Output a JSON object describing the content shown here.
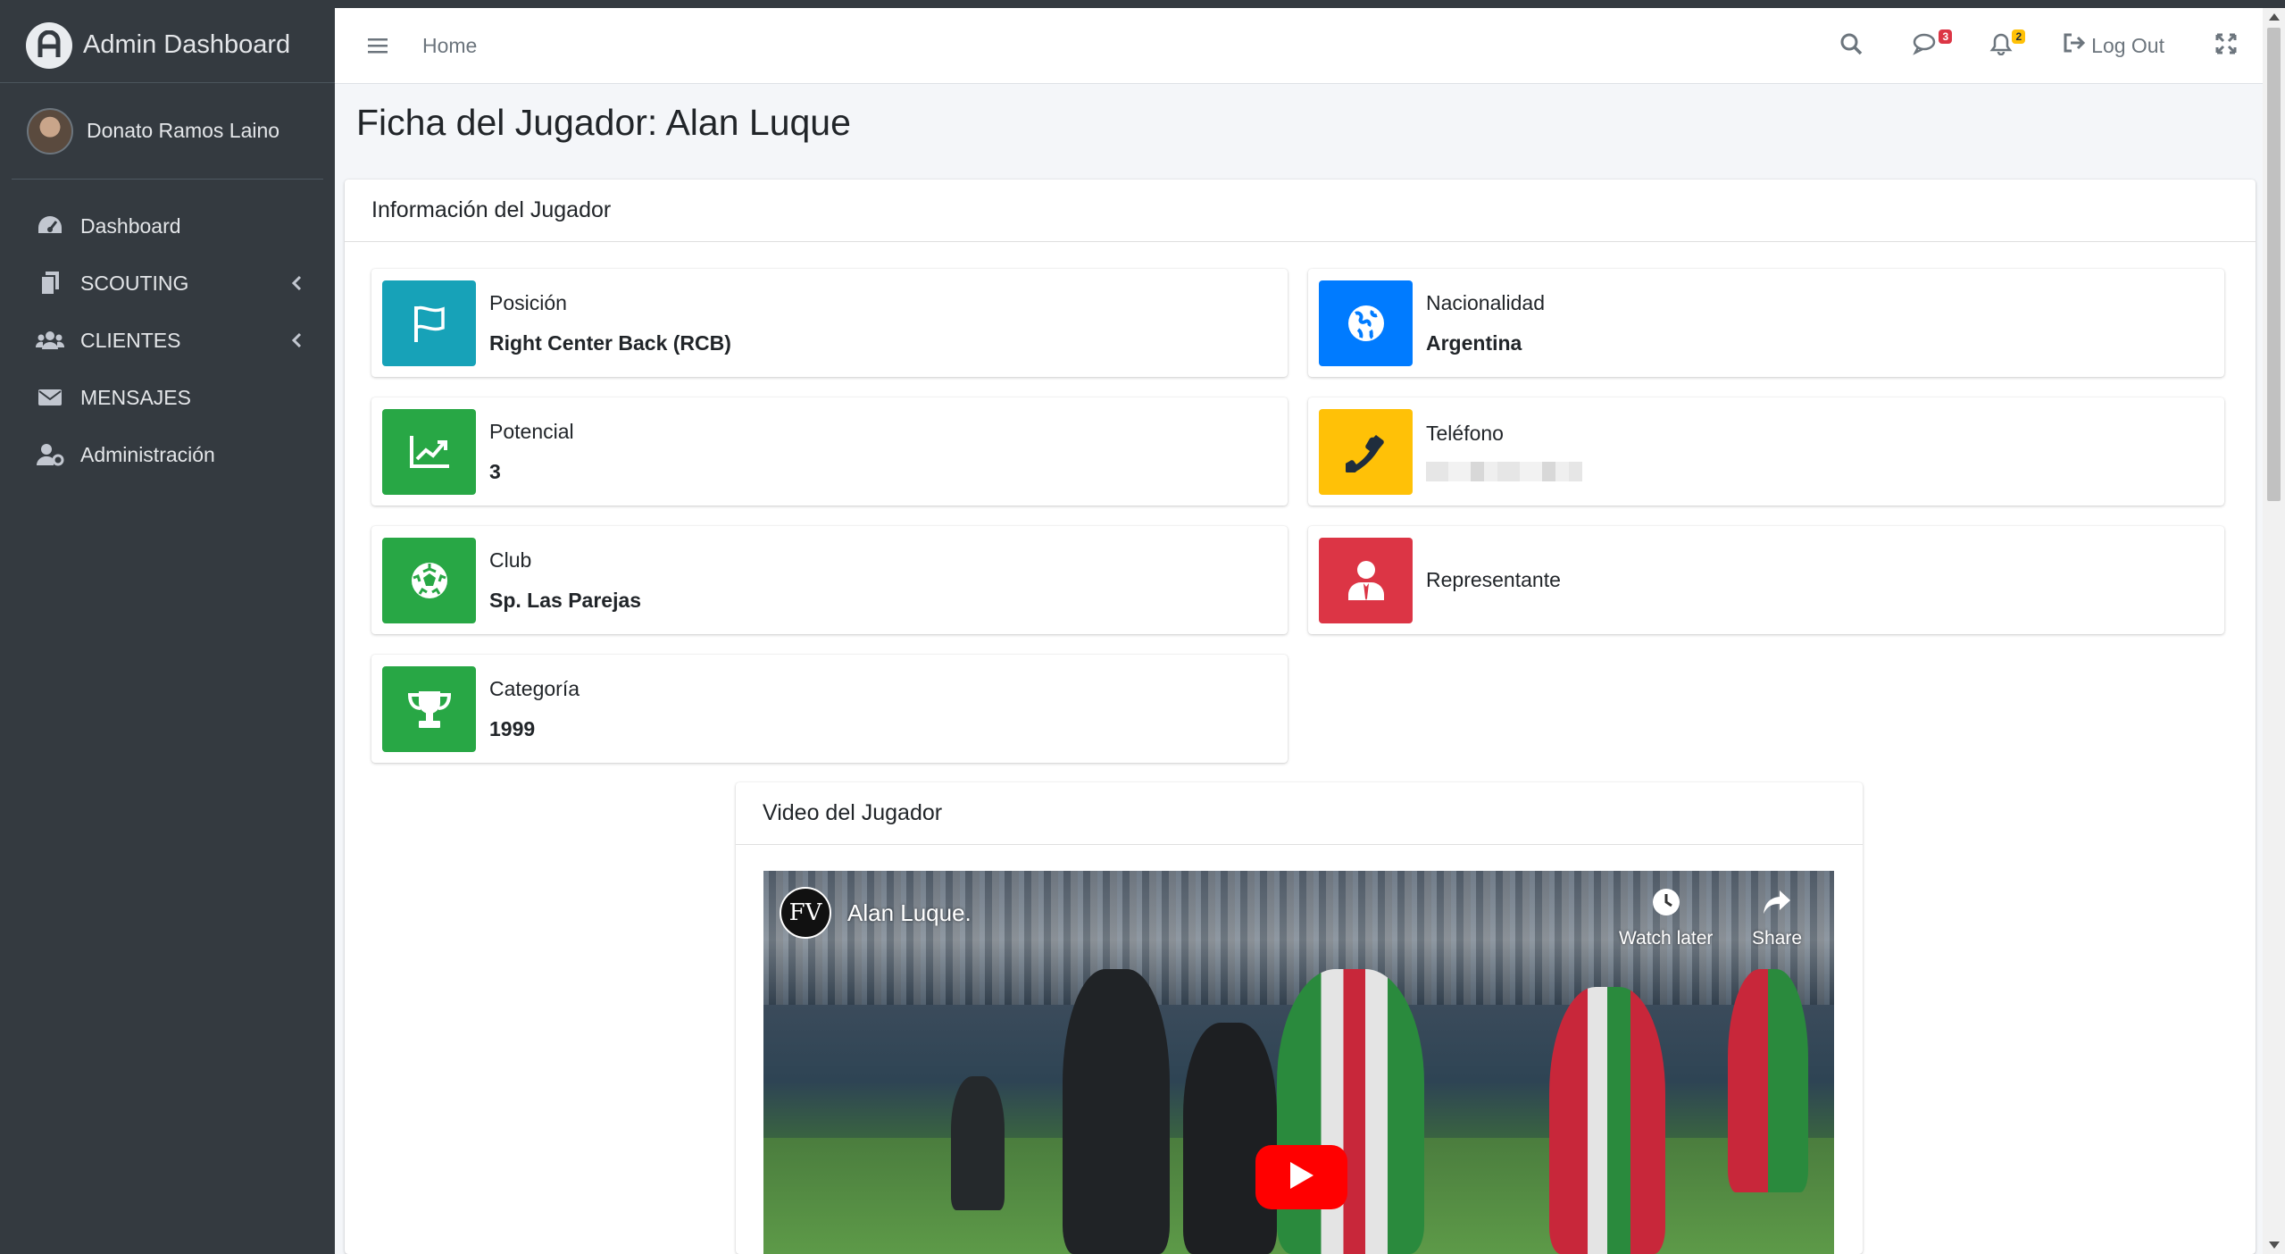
{
  "brand": {
    "title": "Admin Dashboard"
  },
  "user": {
    "name": "Donato Ramos Laino"
  },
  "sidebar": {
    "items": [
      {
        "label": "Dashboard",
        "icon": "tachometer-icon",
        "has_caret": false
      },
      {
        "label": "SCOUTING",
        "icon": "copy-icon",
        "has_caret": true
      },
      {
        "label": "CLIENTES",
        "icon": "users-icon",
        "has_caret": true
      },
      {
        "label": "MENSAJES",
        "icon": "envelope-icon",
        "has_caret": false
      },
      {
        "label": "Administración",
        "icon": "user-cog-icon",
        "has_caret": false
      }
    ]
  },
  "navbar": {
    "home_label": "Home",
    "messages_badge": "3",
    "notifications_badge": "2",
    "logout_label": "Log Out"
  },
  "page": {
    "title": "Ficha del Jugador: Alan Luque"
  },
  "info_card": {
    "header": "Información del Jugador",
    "boxes": {
      "posicion": {
        "label": "Posición",
        "value": "Right Center Back (RCB)",
        "color": "#17a2b8",
        "icon": "flag-icon"
      },
      "nacionalidad": {
        "label": "Nacionalidad",
        "value": "Argentina",
        "color": "#007bff",
        "icon": "globe-icon"
      },
      "potencial": {
        "label": "Potencial",
        "value": "3",
        "color": "#28a745",
        "icon": "chart-line-icon"
      },
      "telefono": {
        "label": "Teléfono",
        "value": "",
        "color": "#ffc107",
        "icon": "phone-icon"
      },
      "club": {
        "label": "Club",
        "value": "Sp. Las Parejas",
        "color": "#28a745",
        "icon": "futbol-icon"
      },
      "representante": {
        "label": "Representante",
        "value": "",
        "color": "#dc3545",
        "icon": "user-tie-icon"
      },
      "categoria": {
        "label": "Categoría",
        "value": "1999",
        "color": "#28a745",
        "icon": "trophy-icon"
      }
    }
  },
  "video_card": {
    "header": "Video del Jugador",
    "video_title": "Alan Luque.",
    "channel_initials": "FV",
    "watch_later_label": "Watch later",
    "share_label": "Share"
  }
}
